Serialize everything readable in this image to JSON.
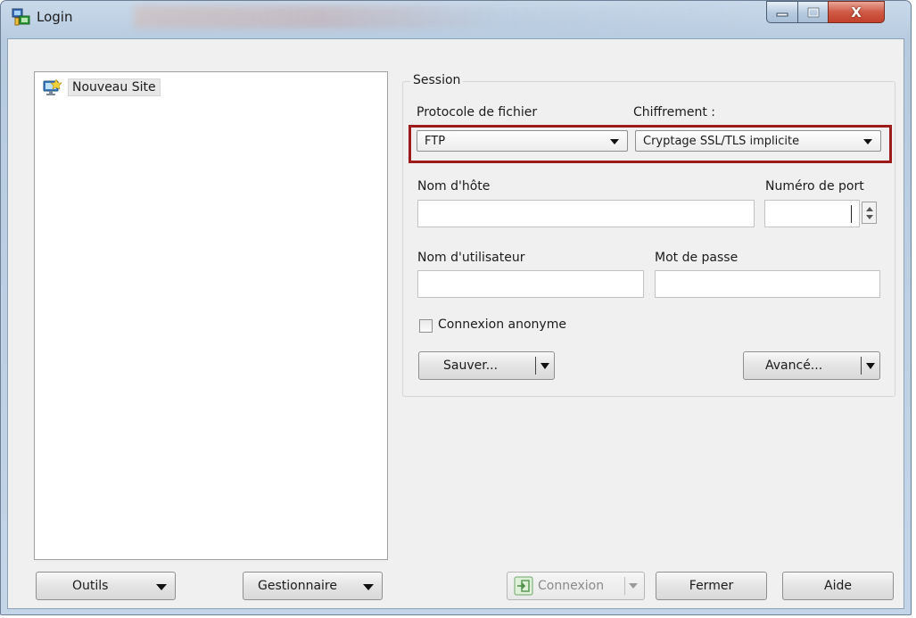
{
  "window": {
    "title": "Login",
    "controls": {
      "minimize_icon": "minimize-icon",
      "maximize_icon": "maximize-icon",
      "close_label": "X"
    }
  },
  "site_tree": {
    "items": [
      {
        "label": "Nouveau Site",
        "icon": "computer-icon"
      }
    ]
  },
  "session": {
    "group_label": "Session",
    "protocol_label": "Protocole de fichier",
    "protocol_value": "FTP",
    "encryption_label": "Chiffrement :",
    "encryption_value": "Cryptage SSL/TLS implicite",
    "host_label": "Nom d'hôte",
    "host_value": "",
    "port_label": "Numéro de port",
    "port_value": "",
    "user_label": "Nom d'utilisateur",
    "user_value": "",
    "password_label": "Mot de passe",
    "password_value": "",
    "anonymous_label": "Connexion anonyme",
    "anonymous_checked": false,
    "save_button": "Sauver...",
    "advanced_button": "Avancé..."
  },
  "footer": {
    "tools_button": "Outils",
    "manager_button": "Gestionnaire",
    "connect_button": "Connexion",
    "close_button": "Fermer",
    "help_button": "Aide"
  },
  "colors": {
    "highlight_border": "#9e1b1b",
    "close_button": "#c2412c",
    "title_bar": "#b7cbe0"
  }
}
